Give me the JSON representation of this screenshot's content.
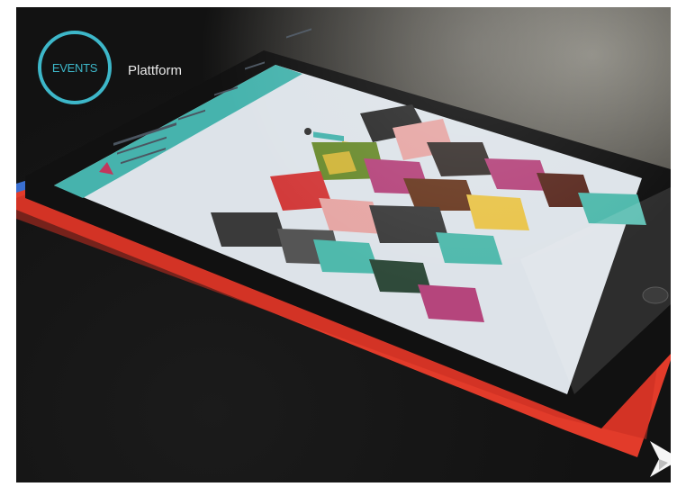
{
  "badge": {
    "label": "EVENTS",
    "ring_color": "#3db7c9"
  },
  "subtitle": "Plattform",
  "colors": {
    "case": "#e23b2a",
    "screen_bg": "#dde3e9",
    "header_teal": "#46b3ad",
    "tile_pink": "#e6a6a4",
    "tile_magenta": "#b5457c",
    "tile_teal": "#4fb9ac",
    "tile_yellow": "#e9c44a"
  },
  "icons": [
    "brand-arrow-icon"
  ]
}
